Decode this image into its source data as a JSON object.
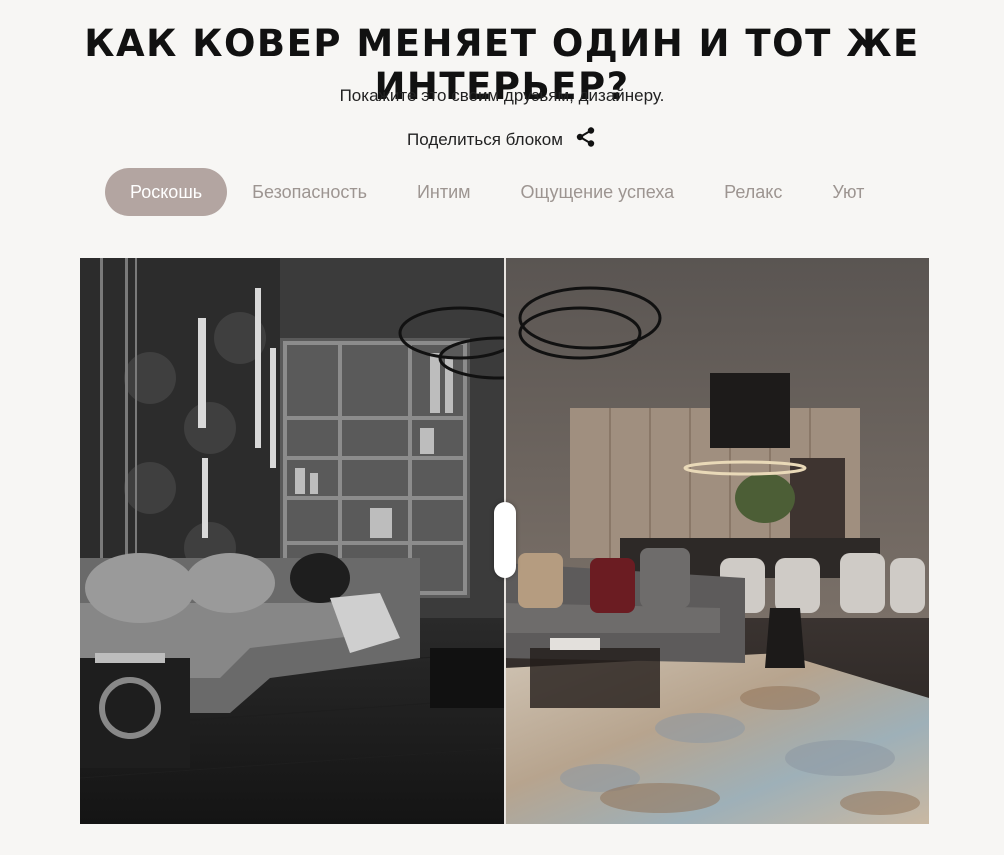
{
  "header": {
    "title": "КАК КОВЕР МЕНЯЕТ ОДИН И ТОТ ЖЕ ИНТЕРЬЕР?",
    "subtitle": "Покажите это своим друзьям, дизайнеру.",
    "share_label": "Поделиться блоком",
    "share_icon": "share-icon"
  },
  "tabs": [
    {
      "label": "Роскошь",
      "active": true
    },
    {
      "label": "Безопасность",
      "active": false
    },
    {
      "label": "Интим",
      "active": false
    },
    {
      "label": "Ощущение успеха",
      "active": false
    },
    {
      "label": "Релакс",
      "active": false
    },
    {
      "label": "Уют",
      "active": false
    }
  ],
  "comparison": {
    "before_image": "grayscale living room without carpet",
    "after_image": "colored living room with patterned carpet",
    "slider_position": 0.5
  },
  "colors": {
    "background": "#f7f6f4",
    "active_tab": "#b3a5a1",
    "inactive_tab_text": "#9d9591"
  }
}
